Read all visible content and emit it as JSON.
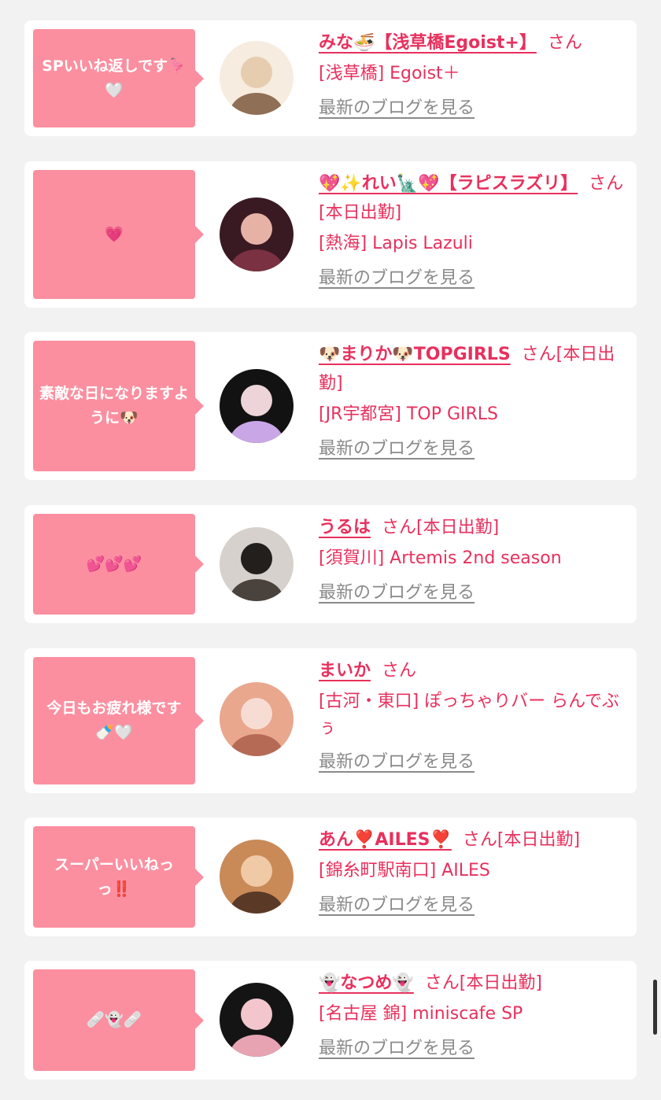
{
  "entries": [
    {
      "message": "SPいいね返しです🦩🤍",
      "name": "みな🍜【浅草橋Egoist+】",
      "honorific": "さん",
      "shop": "[浅草橋] Egoist＋",
      "blog_link": "最新のブログを見る",
      "avatar_colors": [
        "#f6ecdf",
        "#e7cdb0",
        "#8f6f56"
      ]
    },
    {
      "message": "💗",
      "name": "💖✨れい🗽💖【ラピスラズリ】",
      "honorific": "さん[本日出勤]",
      "shop": "[熱海] Lapis Lazuli",
      "blog_link": "最新のブログを見る",
      "avatar_colors": [
        "#3a1a22",
        "#e7b2a6",
        "#7a3142"
      ]
    },
    {
      "message": "素敵な日になりますように🐶",
      "name": "🐶まりか🐶TOPGIRLS",
      "honorific": "さん[本日出勤]",
      "shop": "[JR宇都宮] TOP GIRLS",
      "blog_link": "最新のブログを見る",
      "avatar_colors": [
        "#121212",
        "#ecd4d8",
        "#c9a7e6"
      ]
    },
    {
      "message": "💕💕💕",
      "name": "うるは",
      "honorific": "さん[本日出勤]",
      "shop": "[須賀川] Artemis 2nd season",
      "blog_link": "最新のブログを見る",
      "avatar_colors": [
        "#d6d1cc",
        "#231f1c",
        "#4a423c"
      ]
    },
    {
      "message": "今日もお疲れ様です🍼🤍",
      "name": "まいか",
      "honorific": "さん",
      "shop": "[古河・東口] ぽっちゃりバー らんでぶぅ",
      "blog_link": "最新のブログを見る",
      "avatar_colors": [
        "#e9a78d",
        "#f7dcd4",
        "#b56a56"
      ]
    },
    {
      "message": "スーパーいいねっっ‼️",
      "name": "あん❣️AILES❣️",
      "honorific": "さん[本日出勤]",
      "shop": "[錦糸町駅南口] AILES",
      "blog_link": "最新のブログを見る",
      "avatar_colors": [
        "#c98a58",
        "#f0c9a6",
        "#5a3a26"
      ]
    },
    {
      "message": "🩹👻🩹",
      "name": "👻なつめ👻",
      "honorific": "さん[本日出勤]",
      "shop": "[名古屋 錦] miniscafe SP",
      "blog_link": "最新のブログを見る",
      "avatar_colors": [
        "#141414",
        "#f2c6cc",
        "#e8a3b2"
      ]
    }
  ]
}
